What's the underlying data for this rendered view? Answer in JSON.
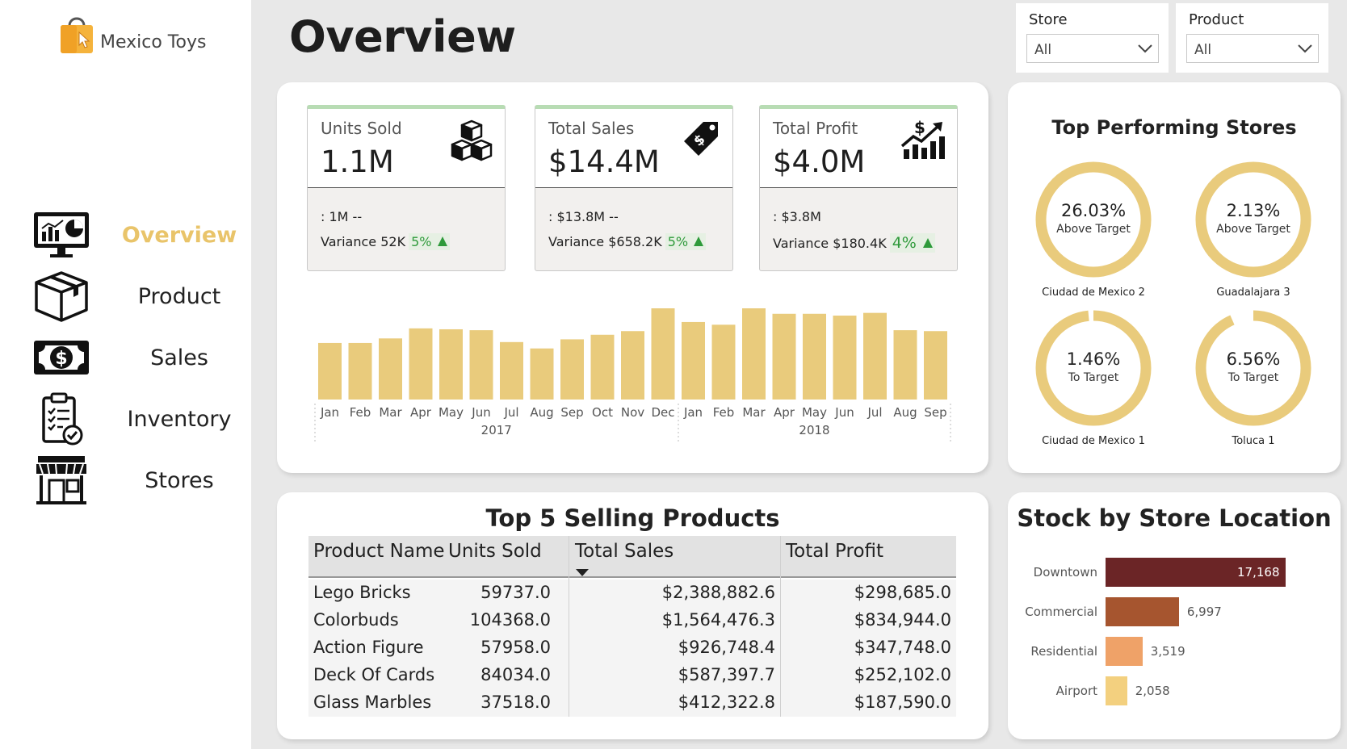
{
  "app": {
    "brand": "Mexico Toys"
  },
  "sidebar": {
    "items": [
      {
        "label": "Overview",
        "icon": "monitor-chart-icon",
        "active": true
      },
      {
        "label": "Product",
        "icon": "box-icon",
        "active": false
      },
      {
        "label": "Sales",
        "icon": "cash-icon",
        "active": false
      },
      {
        "label": "Inventory",
        "icon": "clipboard-check-icon",
        "active": false
      },
      {
        "label": "Stores",
        "icon": "storefront-icon",
        "active": false
      }
    ]
  },
  "header": {
    "title": "Overview"
  },
  "filters": {
    "store": {
      "label": "Store",
      "value": "All"
    },
    "product": {
      "label": "Product",
      "value": "All"
    }
  },
  "kpis": [
    {
      "label": "Units Sold",
      "value": "1.1M",
      "prev": ": 1M --",
      "variance_label": "Variance 52K",
      "variance_pct": "5%",
      "icon": "cubes-icon"
    },
    {
      "label": "Total Sales",
      "value": "$14.4M",
      "prev": ": $13.8M --",
      "variance_label": "Variance $658.2K",
      "variance_pct": "5%",
      "icon": "price-tag-icon"
    },
    {
      "label": "Total Profit",
      "value": "$4.0M",
      "prev": ": $3.8M",
      "variance_label": "Variance $180.4K",
      "variance_pct": "4%",
      "icon": "growth-chart-icon"
    }
  ],
  "chart_data": {
    "type": "bar",
    "title": "",
    "categories": [
      "Jan",
      "Feb",
      "Mar",
      "Apr",
      "May",
      "Jun",
      "Jul",
      "Aug",
      "Sep",
      "Oct",
      "Nov",
      "Dec",
      "Jan",
      "Feb",
      "Mar",
      "Apr",
      "May",
      "Jun",
      "Jul",
      "Aug",
      "Sep"
    ],
    "years": [
      {
        "label": "2017",
        "count": 12
      },
      {
        "label": "2018",
        "count": 9
      }
    ],
    "values": [
      0.62,
      0.62,
      0.67,
      0.78,
      0.77,
      0.76,
      0.63,
      0.56,
      0.66,
      0.71,
      0.75,
      1.0,
      0.85,
      0.82,
      1.0,
      0.94,
      0.94,
      0.92,
      0.95,
      0.76,
      0.75
    ],
    "relative_heights": true,
    "color": "#e9cb7c",
    "grid": false
  },
  "top_stores": {
    "title": "Top Performing Stores",
    "items": [
      {
        "pct": "26.03%",
        "sub": "Above Target",
        "name": "Ciudad de Mexico 2",
        "fill": 1.0
      },
      {
        "pct": "2.13%",
        "sub": "Above Target",
        "name": "Guadalajara 3",
        "fill": 1.0
      },
      {
        "pct": "1.46%",
        "sub": "To Target",
        "name": "Ciudad de Mexico 1",
        "fill": 0.985
      },
      {
        "pct": "6.56%",
        "sub": "To Target",
        "name": "Toluca 1",
        "fill": 0.934
      }
    ],
    "ring_color": "#e9cb7c",
    "track_color": "#ffffff"
  },
  "top_products": {
    "title": "Top 5 Selling Products",
    "columns": [
      "Product Name",
      "Units Sold",
      "Total Sales",
      "Total Profit"
    ],
    "sorted_column": "Total Sales",
    "rows": [
      [
        "Lego Bricks",
        "59737.0",
        "$2,388,882.6",
        "$298,685.0"
      ],
      [
        "Colorbuds",
        "104368.0",
        "$1,564,476.3",
        "$834,944.0"
      ],
      [
        "Action Figure",
        "57958.0",
        "$926,748.4",
        "$347,748.0"
      ],
      [
        "Deck Of Cards",
        "84034.0",
        "$587,397.7",
        "$252,102.0"
      ],
      [
        "Glass Marbles",
        "37518.0",
        "$412,322.8",
        "$187,590.0"
      ]
    ]
  },
  "stock": {
    "title": "Stock by Store Location",
    "items": [
      {
        "label": "Downtown",
        "value": 17168,
        "display": "17,168",
        "color": "#6b2526"
      },
      {
        "label": "Commercial",
        "value": 6997,
        "display": "6,997",
        "color": "#a6552f"
      },
      {
        "label": "Residential",
        "value": 3519,
        "display": "3,519",
        "color": "#efa268"
      },
      {
        "label": "Airport",
        "value": 2058,
        "display": "2,058",
        "color": "#f3d07f"
      }
    ]
  }
}
